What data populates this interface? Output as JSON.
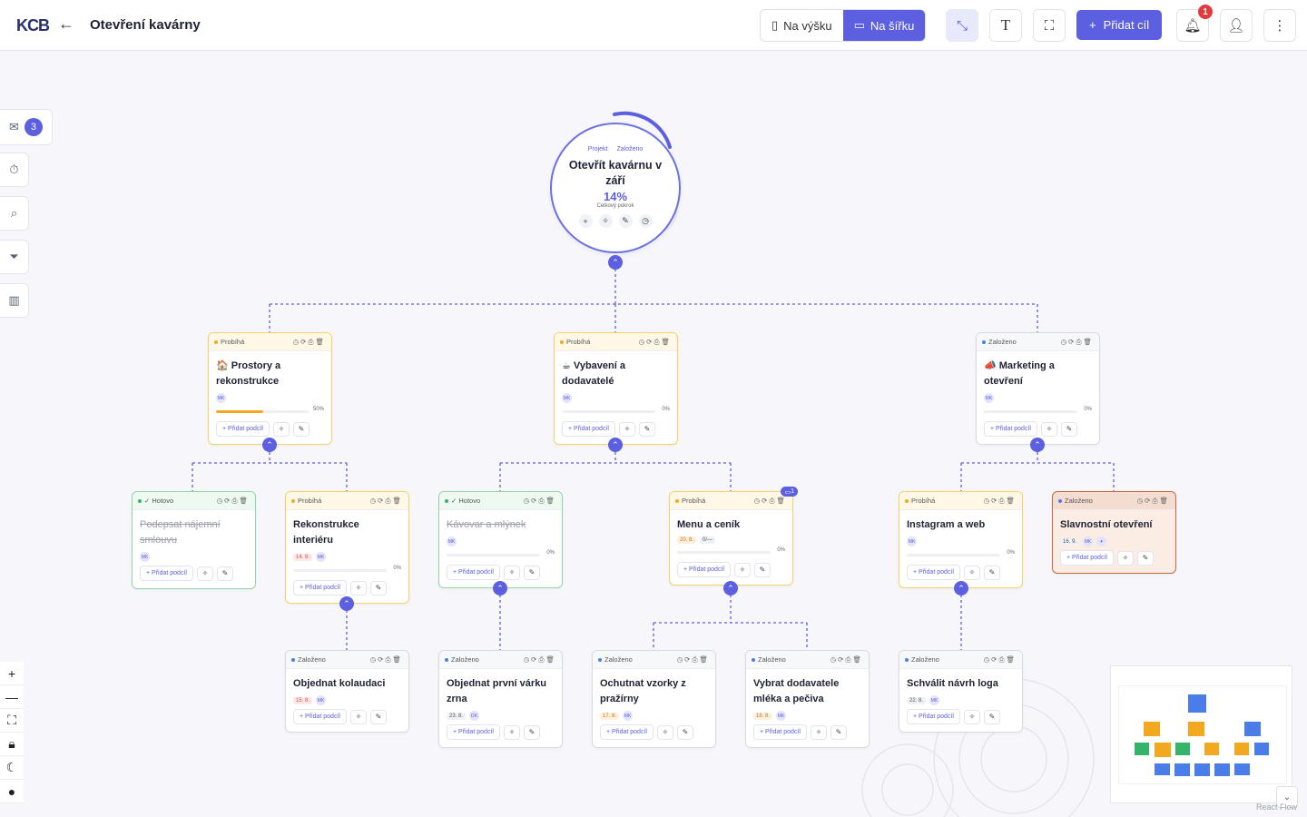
{
  "header": {
    "logo": "KCB",
    "title": "Otevření kavárny",
    "view_portrait": "Na výšku",
    "view_landscape": "Na šířku",
    "add_goal": "Přidat cíl",
    "notification_count": "1"
  },
  "sidebar": {
    "inbox_count": "3"
  },
  "root": {
    "tag_project": "Projekt",
    "tag_status": "Založeno",
    "title": "Otevřít kavárnu v září",
    "progress": "14%",
    "progress_label": "Celkový pokrok"
  },
  "labels": {
    "add_subgoal": "+ Přidat podcíl"
  },
  "cards": [
    {
      "status": "Probíhá",
      "title": "🏠 Prostory a rekonstrukce",
      "avatar": "MK",
      "progress": "50%"
    },
    {
      "status": "Probíhá",
      "title": "☕ Vybavení a dodavatelé",
      "avatar": "MK",
      "progress": "0%"
    },
    {
      "status": "Založeno",
      "title": "📣 Marketing a otevření",
      "avatar": "MK",
      "progress": "0%"
    },
    {
      "status": "✓ Hotovo",
      "title": "Podepsat nájemní smlouvu",
      "avatar": "MK"
    },
    {
      "status": "Probíhá",
      "title": "Rekonstrukce interiéru",
      "date": "14. 8.",
      "avatar": "MK",
      "progress": "0%"
    },
    {
      "status": "✓ Hotovo",
      "title": "Kávovar a mlýnek",
      "avatar": "MK",
      "progress": "0%"
    },
    {
      "status": "Probíhá",
      "title": "Menu a ceník",
      "date": "20. 8.",
      "avatar": "0/—",
      "progress": "0%",
      "comments": "1"
    },
    {
      "status": "Probíhá",
      "title": "Instagram a web",
      "avatar": "MK",
      "progress": "0%"
    },
    {
      "status": "Založeno",
      "title": "Slavnostní otevření",
      "date": "16. 9.",
      "avatar": "MK"
    },
    {
      "status": "Založeno",
      "title": "Objednat kolaudaci",
      "date": "15. 8.",
      "avatar": "MK"
    },
    {
      "status": "Založeno",
      "title": "Objednat první várku zrna",
      "date": "23. 8.",
      "avatar": "DK"
    },
    {
      "status": "Založeno",
      "title": "Ochutnat vzorky z pražírny",
      "date": "17. 8.",
      "avatar": "MK"
    },
    {
      "status": "Založeno",
      "title": "Vybrat dodavatele mléka a pečiva",
      "date": "18. 8.",
      "avatar": "MK"
    },
    {
      "status": "Založeno",
      "title": "Schválit návrh loga",
      "date": "22. 8.",
      "avatar": "MK"
    }
  ],
  "colors": {
    "accent": "#5b5fe0",
    "in_progress": "#f2a81f",
    "done": "#34b36b",
    "created": "#4a7de8"
  },
  "minimap": {
    "attribution": "React Flow"
  }
}
